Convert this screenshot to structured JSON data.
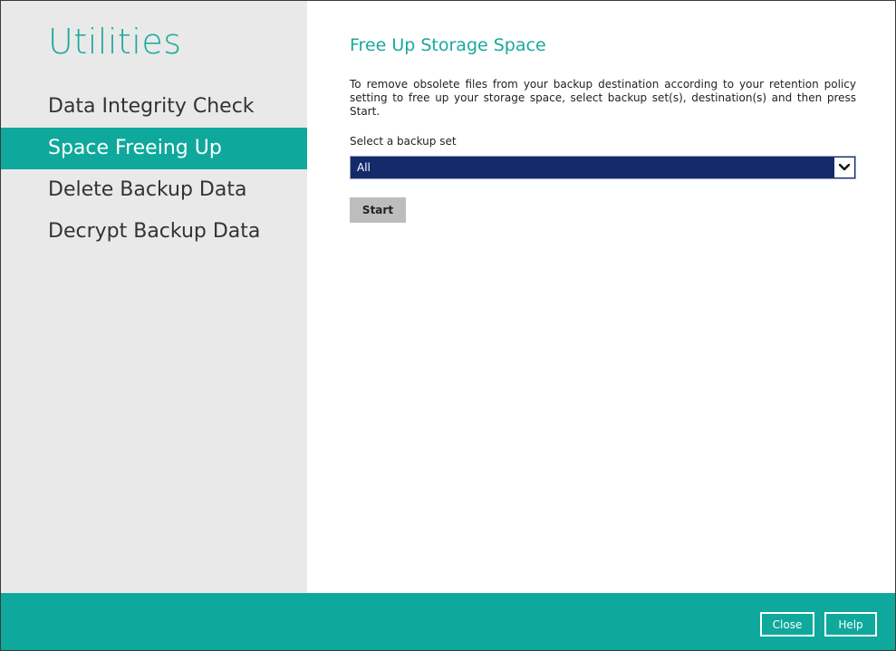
{
  "sidebar": {
    "title": "Utilities",
    "items": [
      {
        "label": "Data Integrity Check",
        "active": false
      },
      {
        "label": "Space Freeing Up",
        "active": true
      },
      {
        "label": "Delete Backup Data",
        "active": false
      },
      {
        "label": "Decrypt Backup Data",
        "active": false
      }
    ]
  },
  "main": {
    "title": "Free Up Storage Space",
    "description": "To remove obsolete files from your backup destination according to your retention policy setting to free up your storage space, select backup set(s), destination(s) and then press Start.",
    "select_label": "Select a backup set",
    "select_value": "All",
    "start_label": "Start"
  },
  "footer": {
    "close_label": "Close",
    "help_label": "Help"
  },
  "colors": {
    "accent": "#0ea99c",
    "sidebar_bg": "#e9e9e9",
    "select_bg": "#132b6b",
    "button_gray": "#bdbdbd"
  },
  "icons": {
    "dropdown": "chevron-down-icon"
  }
}
